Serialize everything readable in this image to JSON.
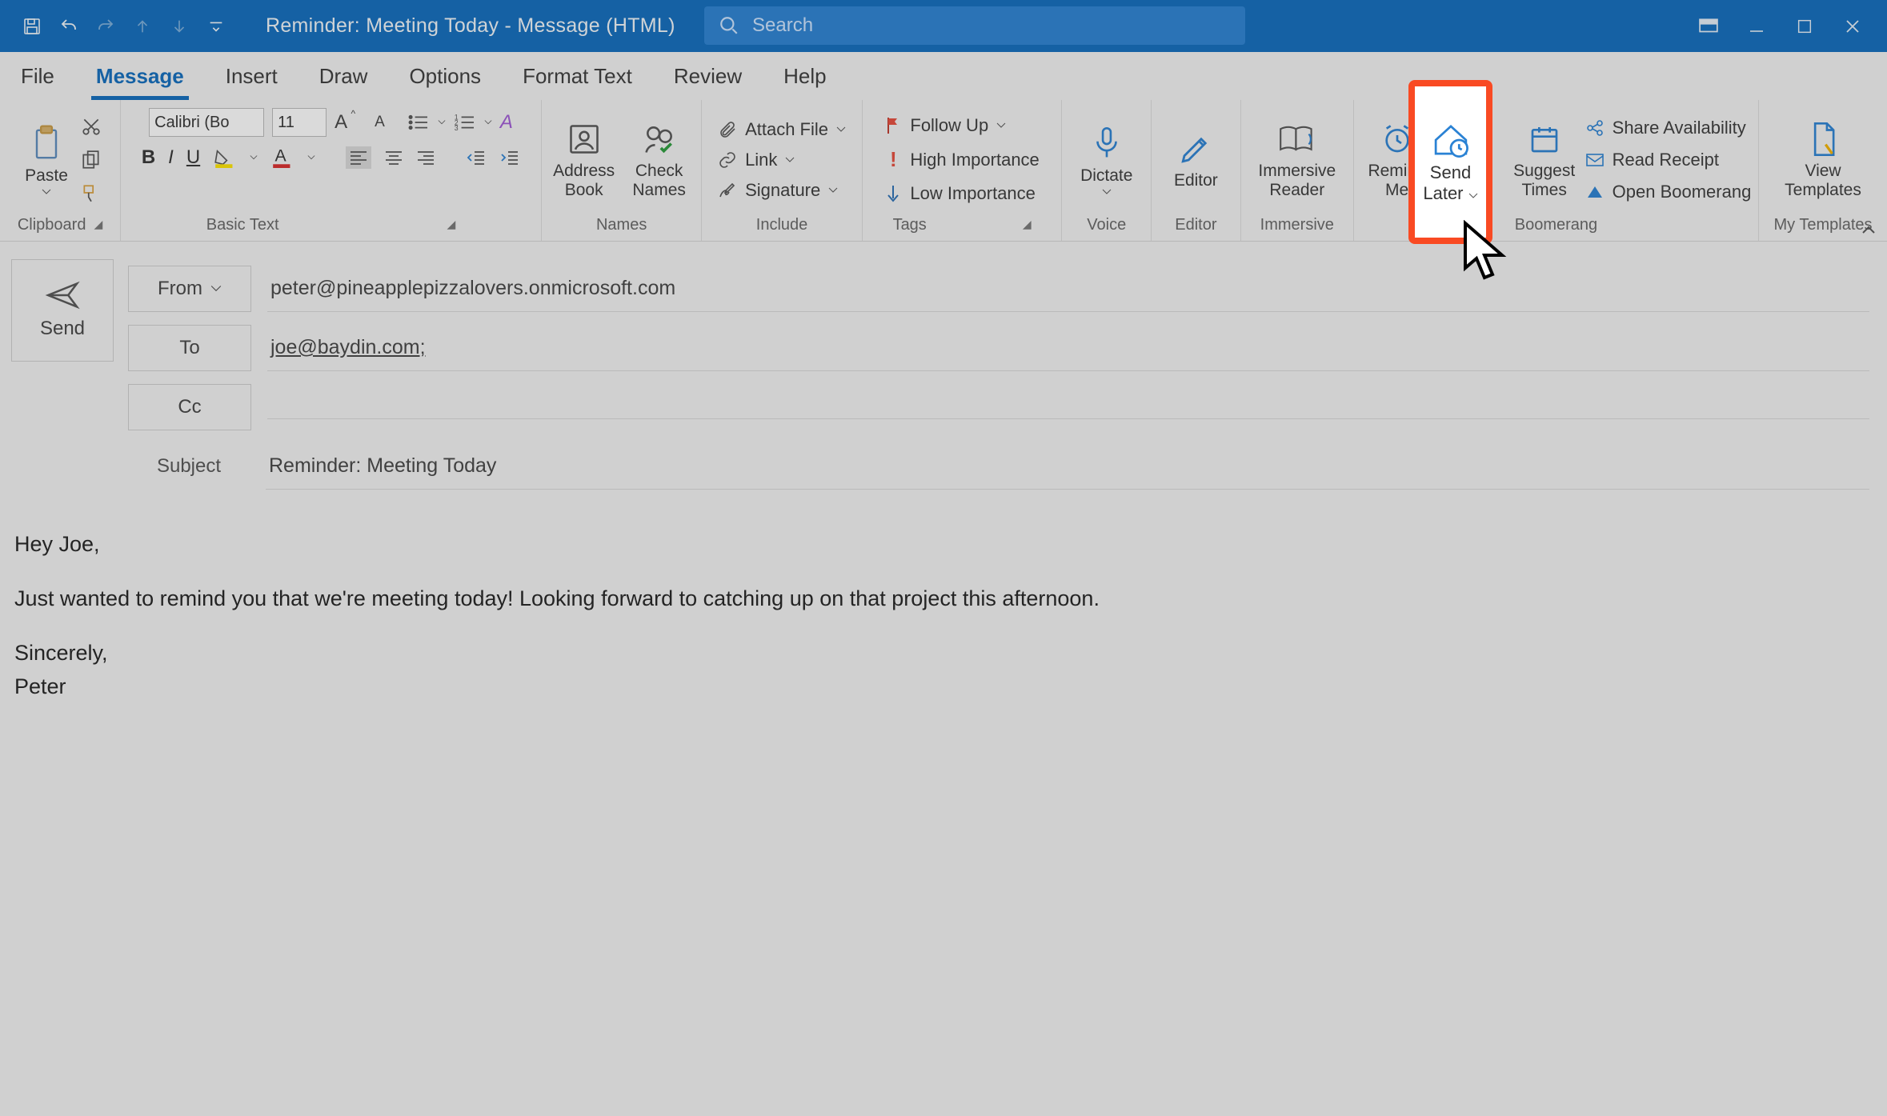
{
  "window": {
    "title": "Reminder: Meeting Today  -  Message (HTML)",
    "search_placeholder": "Search"
  },
  "tabs": {
    "file": "File",
    "message": "Message",
    "insert": "Insert",
    "draw": "Draw",
    "options": "Options",
    "format_text": "Format Text",
    "review": "Review",
    "help": "Help"
  },
  "ribbon": {
    "clipboard": {
      "label": "Clipboard",
      "paste": "Paste"
    },
    "basic_text": {
      "label": "Basic Text",
      "font_name": "Calibri (Bo",
      "font_size": "11"
    },
    "names": {
      "label": "Names",
      "address_book": "Address Book",
      "check_names": "Check Names"
    },
    "include": {
      "label": "Include",
      "attach_file": "Attach File",
      "link": "Link",
      "signature": "Signature"
    },
    "tags": {
      "label": "Tags",
      "follow_up": "Follow Up",
      "high": "High Importance",
      "low": "Low Importance"
    },
    "voice": {
      "label": "Voice",
      "dictate": "Dictate"
    },
    "editor": {
      "label": "Editor",
      "editor": "Editor"
    },
    "immersive": {
      "label": "Immersive",
      "immersive_reader": "Immersive Reader"
    },
    "boomerang": {
      "label": "Boomerang",
      "remind_me": "Remind Me",
      "send_later": "Send Later",
      "suggest_times": "Suggest Times",
      "share_availability": "Share Availability",
      "read_receipt": "Read Receipt",
      "open_boomerang": "Open Boomerang"
    },
    "my_templates": {
      "label": "My Templates",
      "view_templates": "View Templates"
    }
  },
  "compose": {
    "send": "Send",
    "from_label": "From",
    "from_value": "peter@pineapplepizzalovers.onmicrosoft.com",
    "to_label": "To",
    "to_value": "joe@baydin.com;",
    "cc_label": "Cc",
    "cc_value": "",
    "subject_label": "Subject",
    "subject_value": "Reminder: Meeting Today"
  },
  "body": {
    "line1": "Hey Joe,",
    "line2": "Just wanted to remind you that we're meeting today! Looking forward to catching up on that project this afternoon.",
    "line3": "Sincerely,",
    "line4": "Peter"
  }
}
